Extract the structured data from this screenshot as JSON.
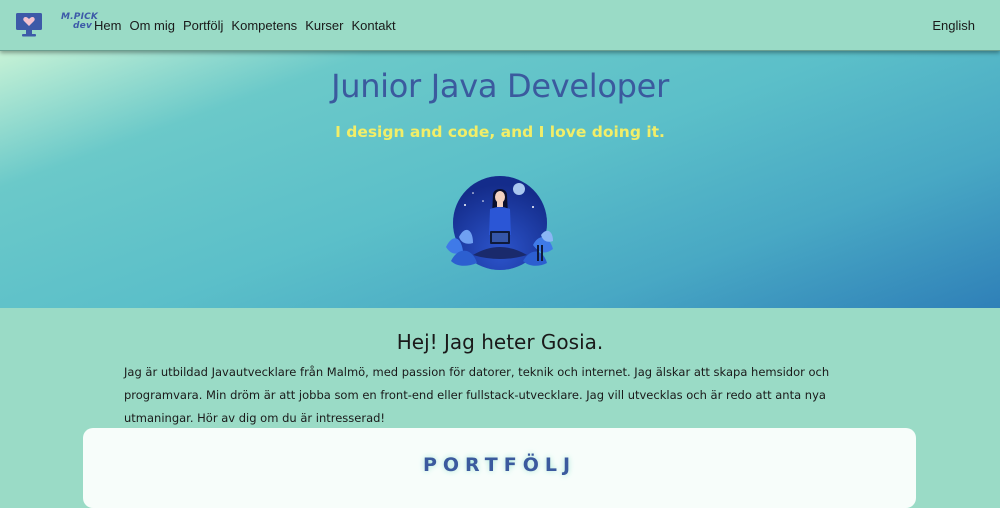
{
  "brand": {
    "logo_line1": "M.PICK",
    "logo_line2": "dev"
  },
  "nav": {
    "items": [
      {
        "label": "Hem"
      },
      {
        "label": "Om mig"
      },
      {
        "label": "Portfölj"
      },
      {
        "label": "Kompetens"
      },
      {
        "label": "Kurser"
      },
      {
        "label": "Kontakt"
      }
    ],
    "language": "English"
  },
  "hero": {
    "title": "Junior Java Developer",
    "subtitle": "I design and code, and I love doing it.",
    "illustration_icon": "developer-with-laptop-illustration"
  },
  "intro": {
    "heading": "Hej! Jag heter Gosia.",
    "text": "Jag är utbildad Javautvecklare från Malmö, med passion för datorer, teknik och internet. Jag älskar att skapa hemsidor och programvara. Min dröm är att jobba som en front-end eller fullstack-utvecklare. Jag vill utvecklas och är redo att anta nya utmaningar. Hör av dig om du är intresserad!"
  },
  "portfolio": {
    "title": "PORTFÖLJ"
  },
  "colors": {
    "background": "#9adbc6",
    "title_blue": "#3b5a9e",
    "subtitle_yellow": "#f2ee68",
    "card": "#f7fdfa"
  }
}
